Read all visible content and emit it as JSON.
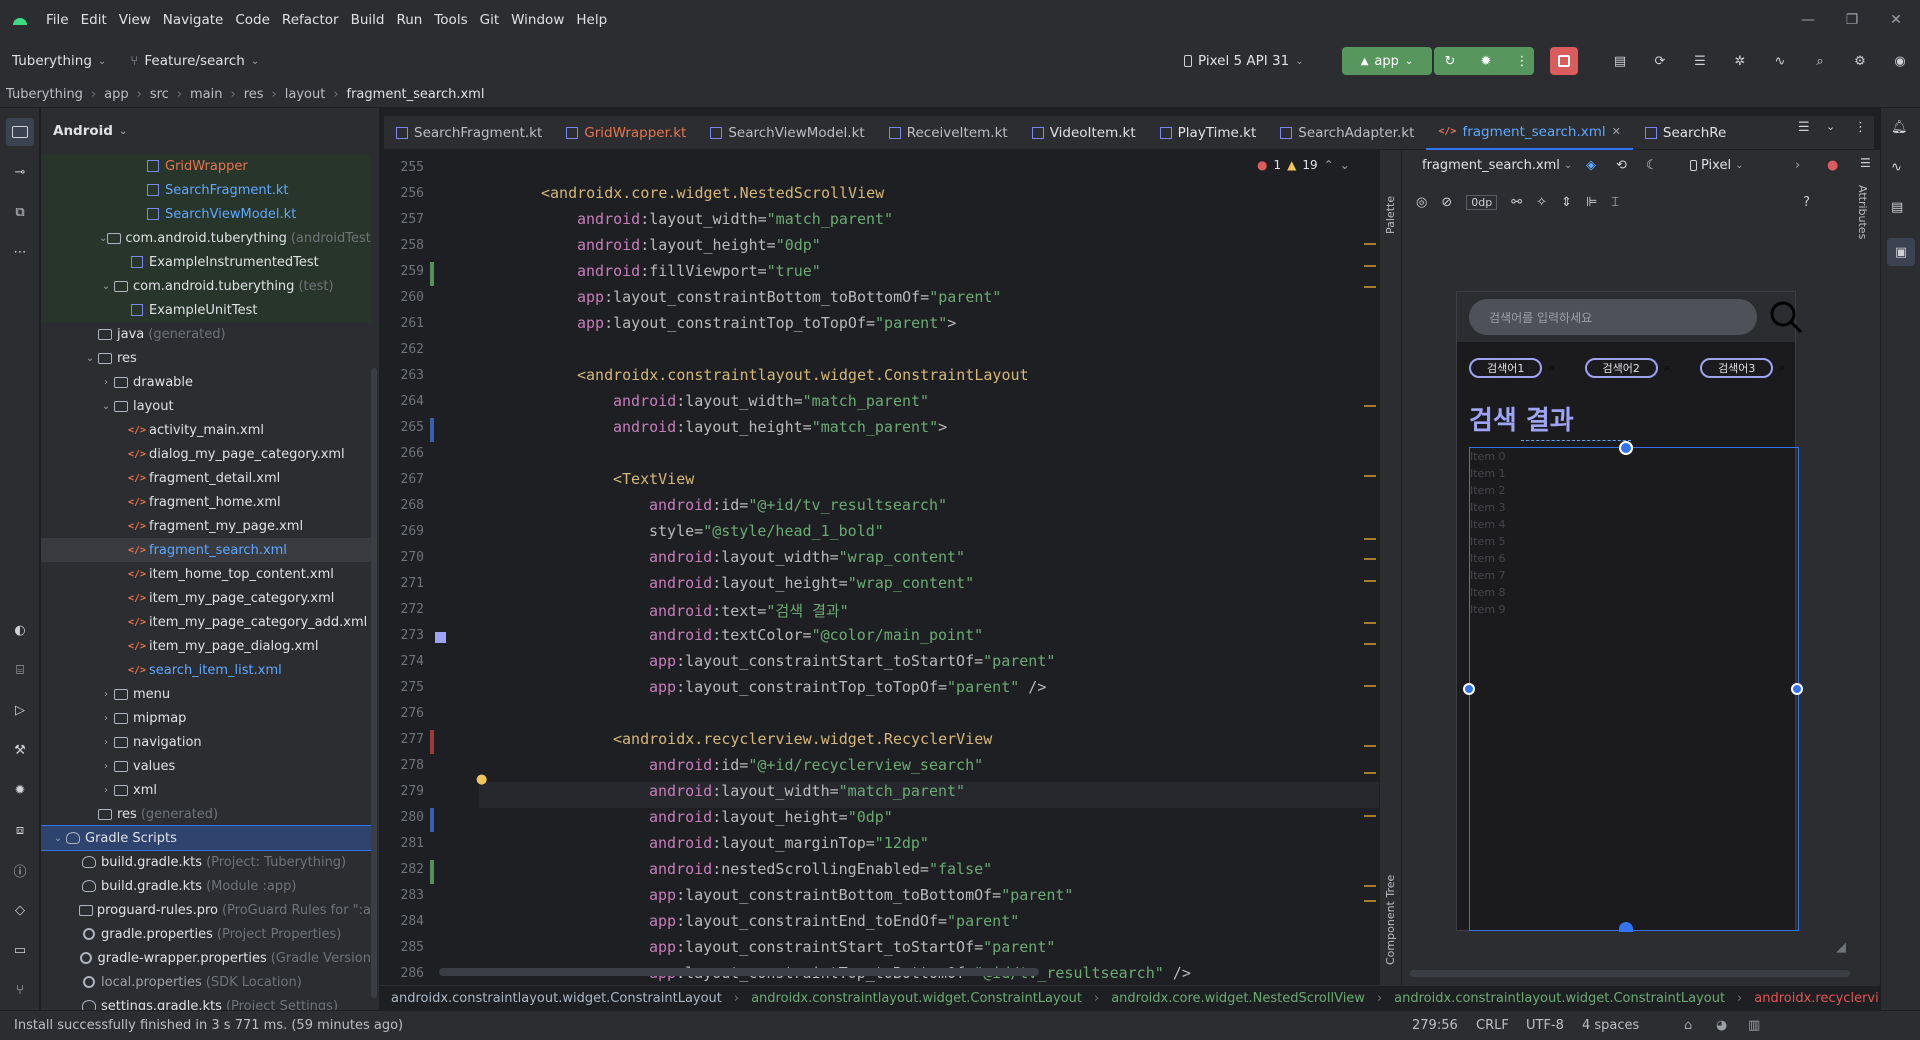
{
  "menu": [
    "File",
    "Edit",
    "View",
    "Navigate",
    "Code",
    "Refactor",
    "Build",
    "Run",
    "Tools",
    "Git",
    "Window",
    "Help"
  ],
  "toolbar": {
    "project": "Tuberything",
    "branch": "Feature/search",
    "device": "Pixel 5 API 31",
    "run_config": "app"
  },
  "breadcrumb": [
    "Tuberything",
    "app",
    "src",
    "main",
    "res",
    "layout",
    "fragment_search.xml"
  ],
  "project_panel": {
    "title": "Android",
    "tree": [
      {
        "label": "GridWrapper",
        "hint": "",
        "type": "kt",
        "depth": 5,
        "arrow": "",
        "color": "#e8744f"
      },
      {
        "label": "SearchFragment.kt",
        "hint": "",
        "type": "kt",
        "depth": 5,
        "arrow": "",
        "color": "#5ea8ff"
      },
      {
        "label": "SearchViewModel.kt",
        "hint": "",
        "type": "kt",
        "depth": 5,
        "arrow": "",
        "color": "#5ea8ff"
      },
      {
        "label": "com.android.tuberything",
        "hint": "(androidTest)",
        "type": "folder",
        "depth": 3,
        "arrow": "v",
        "color": "#dfe1e5"
      },
      {
        "label": "ExampleInstrumentedTest",
        "hint": "",
        "type": "kt",
        "depth": 4,
        "arrow": "",
        "color": "#dfe1e5"
      },
      {
        "label": "com.android.tuberything",
        "hint": "(test)",
        "type": "folder",
        "depth": 3,
        "arrow": "v",
        "color": "#dfe1e5"
      },
      {
        "label": "ExampleUnitTest",
        "hint": "",
        "type": "kt",
        "depth": 4,
        "arrow": "",
        "color": "#dfe1e5"
      },
      {
        "label": "java",
        "hint": "(generated)",
        "type": "folder",
        "depth": 2,
        "arrow": "",
        "color": "#dfe1e5"
      },
      {
        "label": "res",
        "hint": "",
        "type": "folder",
        "depth": 2,
        "arrow": "v",
        "color": "#dfe1e5"
      },
      {
        "label": "drawable",
        "hint": "",
        "type": "folder",
        "depth": 3,
        "arrow": ">",
        "color": "#dfe1e5"
      },
      {
        "label": "layout",
        "hint": "",
        "type": "folder",
        "depth": 3,
        "arrow": "v",
        "color": "#dfe1e5"
      },
      {
        "label": "activity_main.xml",
        "hint": "",
        "type": "xml",
        "depth": 4,
        "arrow": "",
        "color": "#dfe1e5"
      },
      {
        "label": "dialog_my_page_category.xml",
        "hint": "",
        "type": "xml",
        "depth": 4,
        "arrow": "",
        "color": "#dfe1e5"
      },
      {
        "label": "fragment_detail.xml",
        "hint": "",
        "type": "xml",
        "depth": 4,
        "arrow": "",
        "color": "#dfe1e5"
      },
      {
        "label": "fragment_home.xml",
        "hint": "",
        "type": "xml",
        "depth": 4,
        "arrow": "",
        "color": "#dfe1e5"
      },
      {
        "label": "fragment_my_page.xml",
        "hint": "",
        "type": "xml",
        "depth": 4,
        "arrow": "",
        "color": "#dfe1e5"
      },
      {
        "label": "fragment_search.xml",
        "hint": "",
        "type": "xml",
        "depth": 4,
        "arrow": "",
        "color": "#5ea8ff"
      },
      {
        "label": "item_home_top_content.xml",
        "hint": "",
        "type": "xml",
        "depth": 4,
        "arrow": "",
        "color": "#dfe1e5"
      },
      {
        "label": "item_my_page_category.xml",
        "hint": "",
        "type": "xml",
        "depth": 4,
        "arrow": "",
        "color": "#dfe1e5"
      },
      {
        "label": "item_my_page_category_add.xml",
        "hint": "",
        "type": "xml",
        "depth": 4,
        "arrow": "",
        "color": "#dfe1e5"
      },
      {
        "label": "item_my_page_dialog.xml",
        "hint": "",
        "type": "xml",
        "depth": 4,
        "arrow": "",
        "color": "#dfe1e5"
      },
      {
        "label": "search_item_list.xml",
        "hint": "",
        "type": "xml",
        "depth": 4,
        "arrow": "",
        "color": "#5ea8ff"
      },
      {
        "label": "menu",
        "hint": "",
        "type": "folder",
        "depth": 3,
        "arrow": ">",
        "color": "#dfe1e5"
      },
      {
        "label": "mipmap",
        "hint": "",
        "type": "folder",
        "depth": 3,
        "arrow": ">",
        "color": "#dfe1e5"
      },
      {
        "label": "navigation",
        "hint": "",
        "type": "folder",
        "depth": 3,
        "arrow": ">",
        "color": "#dfe1e5"
      },
      {
        "label": "values",
        "hint": "",
        "type": "folder",
        "depth": 3,
        "arrow": ">",
        "color": "#dfe1e5"
      },
      {
        "label": "xml",
        "hint": "",
        "type": "folder",
        "depth": 3,
        "arrow": ">",
        "color": "#dfe1e5"
      },
      {
        "label": "res",
        "hint": "(generated)",
        "type": "folder",
        "depth": 2,
        "arrow": "",
        "color": "#dfe1e5"
      },
      {
        "label": "Gradle Scripts",
        "hint": "",
        "type": "gradle",
        "depth": 0,
        "arrow": "v",
        "color": "#dfe1e5"
      },
      {
        "label": "build.gradle.kts",
        "hint": "(Project: Tuberything)",
        "type": "gradle",
        "depth": 1,
        "arrow": "",
        "color": "#dfe1e5"
      },
      {
        "label": "build.gradle.kts",
        "hint": "(Module :app)",
        "type": "gradle",
        "depth": 1,
        "arrow": "",
        "color": "#dfe1e5"
      },
      {
        "label": "proguard-rules.pro",
        "hint": "(ProGuard Rules for \":a",
        "type": "file",
        "depth": 1,
        "arrow": "",
        "color": "#dfe1e5"
      },
      {
        "label": "gradle.properties",
        "hint": "(Project Properties)",
        "type": "gear",
        "depth": 1,
        "arrow": "",
        "color": "#dfe1e5"
      },
      {
        "label": "gradle-wrapper.properties",
        "hint": "(Gradle Version",
        "type": "gear",
        "depth": 1,
        "arrow": "",
        "color": "#dfe1e5"
      },
      {
        "label": "local.properties",
        "hint": "(SDK Location)",
        "type": "gear",
        "depth": 1,
        "arrow": "",
        "color": "#9da0a8"
      },
      {
        "label": "settings.gradle.kts",
        "hint": "(Project Settings)",
        "type": "gradle",
        "depth": 1,
        "arrow": "",
        "color": "#dfe1e5"
      }
    ]
  },
  "tabs": [
    {
      "label": "SearchFragment.kt",
      "type": "kt",
      "color": "#bcbec4"
    },
    {
      "label": "GridWrapper.kt",
      "type": "kt",
      "color": "#e8744f"
    },
    {
      "label": "SearchViewModel.kt",
      "type": "kt",
      "color": "#bcbec4"
    },
    {
      "label": "ReceiveItem.kt",
      "type": "kt",
      "color": "#bcbec4"
    },
    {
      "label": "VideoItem.kt",
      "type": "kt",
      "color": "#dfe1e5"
    },
    {
      "label": "PlayTime.kt",
      "type": "kt",
      "color": "#dfe1e5"
    },
    {
      "label": "SearchAdapter.kt",
      "type": "kt",
      "color": "#bcbec4"
    },
    {
      "label": "fragment_search.xml",
      "type": "xml",
      "color": "#5ea8ff"
    },
    {
      "label": "SearchRe",
      "type": "kt",
      "color": "#dfe1e5"
    }
  ],
  "editor": {
    "problems_errors": "1",
    "problems_warnings": "19",
    "lines": [
      {
        "n": "255",
        "indent": 0,
        "html": ""
      },
      {
        "n": "256",
        "indent": 1,
        "parts": [
          [
            "tag",
            "<androidx.core.widget.NestedScrollView"
          ]
        ]
      },
      {
        "n": "257",
        "indent": 2,
        "parts": [
          [
            "attr-ns",
            "android"
          ],
          [
            "attr",
            ":layout_width="
          ],
          [
            "val",
            "\"match_parent\""
          ]
        ]
      },
      {
        "n": "258",
        "indent": 2,
        "parts": [
          [
            "attr-ns",
            "android"
          ],
          [
            "attr",
            ":layout_height="
          ],
          [
            "val",
            "\"0dp\""
          ]
        ]
      },
      {
        "n": "259",
        "indent": 2,
        "parts": [
          [
            "attr-ns",
            "android"
          ],
          [
            "attr",
            ":fillViewport="
          ],
          [
            "val",
            "\"true\""
          ]
        ]
      },
      {
        "n": "260",
        "indent": 2,
        "parts": [
          [
            "attr-ns",
            "app"
          ],
          [
            "attr",
            ":layout_constraintBottom_toBottomOf="
          ],
          [
            "val",
            "\"parent\""
          ]
        ]
      },
      {
        "n": "261",
        "indent": 2,
        "parts": [
          [
            "attr-ns",
            "app"
          ],
          [
            "attr",
            ":layout_constraintTop_toTopOf="
          ],
          [
            "val",
            "\"parent\""
          ],
          [
            "attr",
            ">"
          ]
        ]
      },
      {
        "n": "262",
        "indent": 0,
        "parts": []
      },
      {
        "n": "263",
        "indent": 2,
        "parts": [
          [
            "tag",
            "<androidx.constraintlayout.widget.ConstraintLayout"
          ]
        ]
      },
      {
        "n": "264",
        "indent": 3,
        "parts": [
          [
            "attr-ns",
            "android"
          ],
          [
            "attr",
            ":layout_width="
          ],
          [
            "val",
            "\"match_parent\""
          ]
        ]
      },
      {
        "n": "265",
        "indent": 3,
        "parts": [
          [
            "attr-ns",
            "android"
          ],
          [
            "attr",
            ":layout_height="
          ],
          [
            "val",
            "\"match_parent\""
          ],
          [
            "attr",
            ">"
          ]
        ]
      },
      {
        "n": "266",
        "indent": 0,
        "parts": []
      },
      {
        "n": "267",
        "indent": 3,
        "parts": [
          [
            "tag",
            "<TextView"
          ]
        ]
      },
      {
        "n": "268",
        "indent": 4,
        "parts": [
          [
            "attr-ns",
            "android"
          ],
          [
            "attr",
            ":id="
          ],
          [
            "val",
            "\"@+id/tv_resultsearch\""
          ]
        ]
      },
      {
        "n": "269",
        "indent": 4,
        "parts": [
          [
            "attr",
            "style="
          ],
          [
            "val",
            "\"@style/head_1_bold\""
          ]
        ]
      },
      {
        "n": "270",
        "indent": 4,
        "parts": [
          [
            "attr-ns",
            "android"
          ],
          [
            "attr",
            ":layout_width="
          ],
          [
            "val",
            "\"wrap_content\""
          ]
        ]
      },
      {
        "n": "271",
        "indent": 4,
        "parts": [
          [
            "attr-ns",
            "android"
          ],
          [
            "attr",
            ":layout_height="
          ],
          [
            "val",
            "\"wrap_content\""
          ]
        ]
      },
      {
        "n": "272",
        "indent": 4,
        "parts": [
          [
            "attr-ns",
            "android"
          ],
          [
            "attr",
            ":text="
          ],
          [
            "val",
            "\"검색 결과\""
          ]
        ]
      },
      {
        "n": "273",
        "indent": 4,
        "parts": [
          [
            "attr-ns",
            "android"
          ],
          [
            "attr",
            ":textColor="
          ],
          [
            "val",
            "\"@color/main_point\""
          ]
        ]
      },
      {
        "n": "274",
        "indent": 4,
        "parts": [
          [
            "attr-ns",
            "app"
          ],
          [
            "attr",
            ":layout_constraintStart_toStartOf="
          ],
          [
            "val",
            "\"parent\""
          ]
        ]
      },
      {
        "n": "275",
        "indent": 4,
        "parts": [
          [
            "attr-ns",
            "app"
          ],
          [
            "attr",
            ":layout_constraintTop_toTopOf="
          ],
          [
            "val",
            "\"parent\""
          ],
          [
            "attr",
            " />"
          ]
        ]
      },
      {
        "n": "276",
        "indent": 0,
        "parts": []
      },
      {
        "n": "277",
        "indent": 3,
        "parts": [
          [
            "tag",
            "<androidx.recyclerview.widget.RecyclerView"
          ]
        ]
      },
      {
        "n": "278",
        "indent": 4,
        "parts": [
          [
            "attr-ns",
            "android"
          ],
          [
            "attr",
            ":id="
          ],
          [
            "val",
            "\"@+id/recyclerview_search\""
          ]
        ]
      },
      {
        "n": "279",
        "indent": 4,
        "parts": [
          [
            "attr-ns",
            "android"
          ],
          [
            "attr",
            ":layout_width="
          ],
          [
            "val",
            "\"match_parent\""
          ]
        ]
      },
      {
        "n": "280",
        "indent": 4,
        "parts": [
          [
            "attr-ns",
            "android"
          ],
          [
            "attr",
            ":layout_height="
          ],
          [
            "val",
            "\"0dp\""
          ]
        ]
      },
      {
        "n": "281",
        "indent": 4,
        "parts": [
          [
            "attr-ns",
            "android"
          ],
          [
            "attr",
            ":layout_marginTop="
          ],
          [
            "val",
            "\"12dp\""
          ]
        ]
      },
      {
        "n": "282",
        "indent": 4,
        "parts": [
          [
            "attr-ns",
            "android"
          ],
          [
            "attr",
            ":nestedScrollingEnabled="
          ],
          [
            "val",
            "\"false\""
          ]
        ]
      },
      {
        "n": "283",
        "indent": 4,
        "parts": [
          [
            "attr-ns",
            "app"
          ],
          [
            "attr",
            ":layout_constraintBottom_toBottomOf="
          ],
          [
            "val",
            "\"parent\""
          ]
        ]
      },
      {
        "n": "284",
        "indent": 4,
        "parts": [
          [
            "attr-ns",
            "app"
          ],
          [
            "attr",
            ":layout_constraintEnd_toEndOf="
          ],
          [
            "val",
            "\"parent\""
          ]
        ]
      },
      {
        "n": "285",
        "indent": 4,
        "parts": [
          [
            "attr-ns",
            "app"
          ],
          [
            "attr",
            ":layout_constraintStart_toStartOf="
          ],
          [
            "val",
            "\"parent\""
          ]
        ]
      },
      {
        "n": "286",
        "indent": 4,
        "parts": [
          [
            "attr-ns",
            "app"
          ],
          [
            "attr",
            ":layout_constraintTop_toBottomOf="
          ],
          [
            "val",
            "\"@id/tv_resultsearch\""
          ],
          [
            "attr",
            " />"
          ]
        ]
      }
    ]
  },
  "design": {
    "file_selector": "fragment_search.xml",
    "device_selector": "Pixel",
    "dp_value": "0dp",
    "side_palette": "Palette",
    "side_tree": "Component Tree",
    "side_attributes": "Attributes",
    "preview": {
      "search_placeholder": "검색어를 입력하세요",
      "chips": [
        "검색어1",
        "검색어2",
        "검색어3"
      ],
      "result_title": "검색 결과",
      "items": [
        "Item 0",
        "Item 1",
        "Item 2",
        "Item 3",
        "Item 4",
        "Item 5",
        "Item 6",
        "Item 7",
        "Item 8",
        "Item 9"
      ]
    }
  },
  "bottom_crumbs": [
    "androidx.constraintlayout.widget.ConstraintLayout",
    "androidx.constraintlayout.widget.ConstraintLayout",
    "androidx.core.widget.NestedScrollView",
    "androidx.constraintlayout.widget.ConstraintLayout",
    "androidx.recyclerview.widget.RecyclerView"
  ],
  "status": {
    "message": "Install successfully finished in 3 s 771 ms. (59 minutes ago)",
    "position": "279:56",
    "line_sep": "CRLF",
    "encoding": "UTF-8",
    "indent": "4 spaces"
  },
  "colors": {
    "accent": "#3574f0",
    "run_green": "#57965c",
    "stop_red": "#db5c5c",
    "brand": "#9ea4f5"
  }
}
